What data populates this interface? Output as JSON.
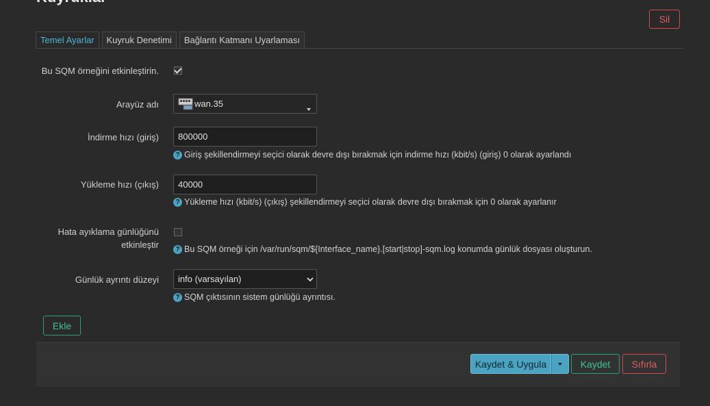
{
  "page": {
    "title": "Kuyruklar"
  },
  "delete_label": "Sil",
  "tabs": [
    {
      "label": "Temel Ayarlar",
      "active": true
    },
    {
      "label": "Kuyruk Denetimi",
      "active": false
    },
    {
      "label": "Bağlantı Katmanı Uyarlaması",
      "active": false
    }
  ],
  "form": {
    "enable": {
      "label": "Bu SQM örneğini etkinleştirin.",
      "checked": true
    },
    "interface": {
      "label": "Arayüz adı",
      "value": "wan.35",
      "icon": "network-port-icon"
    },
    "download": {
      "label": "İndirme hızı (giriş)",
      "value": "800000",
      "help": "Giriş şekillendirmeyi seçici olarak devre dışı bırakmak için indirme hızı (kbit/s) (giriş) 0 olarak ayarlandı"
    },
    "upload": {
      "label": "Yükleme hızı (çıkış)",
      "value": "40000",
      "help": "Yükleme hızı (kbit/s) (çıkış) şekillendirmeyi seçici olarak devre dışı bırakmak için 0 olarak ayarlanır"
    },
    "debug": {
      "label_line1": "Hata ayıklama günlüğünü",
      "label_line2": "etkinleştir",
      "checked": false,
      "help": "Bu SQM örneği için /var/run/sqm/${Interface_name}.[start|stop]-sqm.log konumda günlük dosyası oluşturun."
    },
    "log_level": {
      "label": "Günlük ayrıntı düzeyi",
      "value": "info (varsayılan)",
      "help": "SQM çıktısının sistem günlüğü ayrıntısı."
    }
  },
  "add_label": "Ekle",
  "footer": {
    "save_apply": "Kaydet & Uygula",
    "save": "Kaydet",
    "reset": "Sıfırla"
  },
  "colors": {
    "accent": "#4aa3c1",
    "danger": "#d64b4b",
    "success": "#2ca47a"
  }
}
